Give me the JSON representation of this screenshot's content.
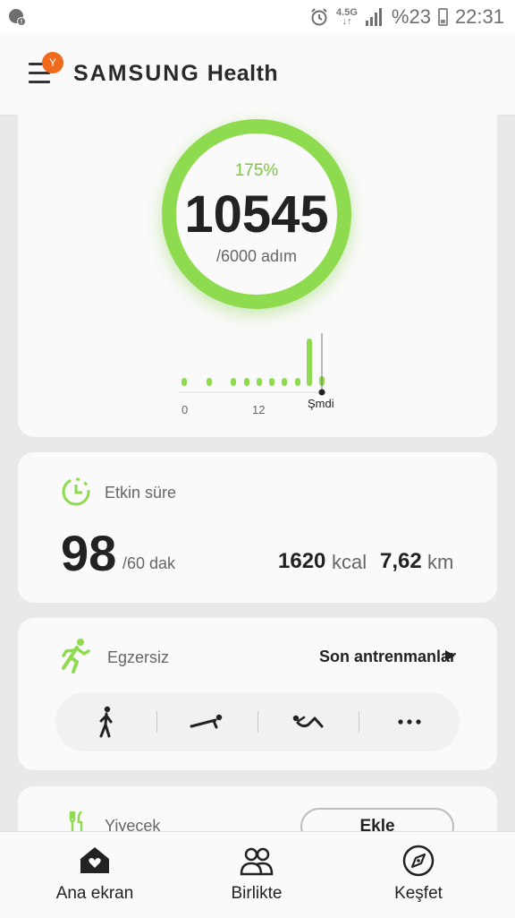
{
  "status_bar": {
    "network": "4.5G",
    "battery_text": "%23",
    "time": "22:31"
  },
  "app": {
    "brand_samsung": "SAMSUNG",
    "brand_health": "Health",
    "profile_badge": "Y"
  },
  "steps_card": {
    "percent": "175%",
    "steps": "10545",
    "goal": "/6000 adım",
    "timeline_start": "0",
    "timeline_mid": "12",
    "timeline_now": "Şmdi"
  },
  "active_card": {
    "title": "Etkin süre",
    "minutes": "98",
    "minutes_goal": "/60 dak",
    "kcal_value": "1620",
    "kcal_unit": "kcal",
    "km_value": "7,62",
    "km_unit": "km"
  },
  "exercise_card": {
    "title": "Egzersiz",
    "recent_link": "Son antrenmanlar",
    "shortcuts": [
      "walk-icon",
      "pushup-icon",
      "situp-icon",
      "more-icon"
    ]
  },
  "food_card": {
    "title": "Yiyecek",
    "add_button": "Ekle"
  },
  "bottom_nav": {
    "home": "Ana ekran",
    "together": "Birlikte",
    "discover": "Keşfet"
  },
  "colors": {
    "accent_green": "#8fdb4f",
    "badge_orange": "#f06a1d"
  }
}
